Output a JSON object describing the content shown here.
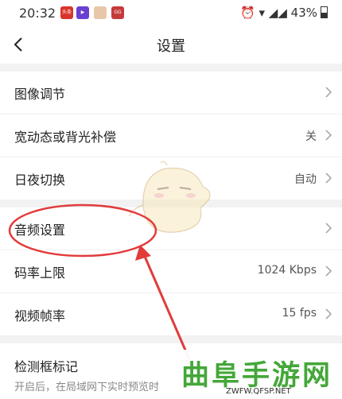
{
  "status_bar": {
    "time": "20:32",
    "battery": "43%",
    "battery_level": 0.43,
    "app_icons": [
      "news-app-icon",
      "video-app-icon",
      "avatar-app-icon",
      "game-app-icon"
    ]
  },
  "header": {
    "title": "设置"
  },
  "settings": {
    "group1": [
      {
        "label": "图像调节",
        "value": ""
      },
      {
        "label": "宽动态或背光补偿",
        "value": "关"
      },
      {
        "label": "日夜切换",
        "value": "自动"
      }
    ],
    "group2": [
      {
        "label": "音频设置",
        "value": ""
      },
      {
        "label": "码率上限",
        "value": "1024 Kbps"
      },
      {
        "label": "视频帧率",
        "value": "15 fps"
      }
    ],
    "group3": {
      "label": "检测框标记",
      "description": "开启后，在局域网下实时预览时"
    }
  },
  "annotation": {
    "color": "#e23b3b"
  },
  "watermark": {
    "brand": "曲阜手游网",
    "url": "ZWFW.QFSP.NET"
  }
}
